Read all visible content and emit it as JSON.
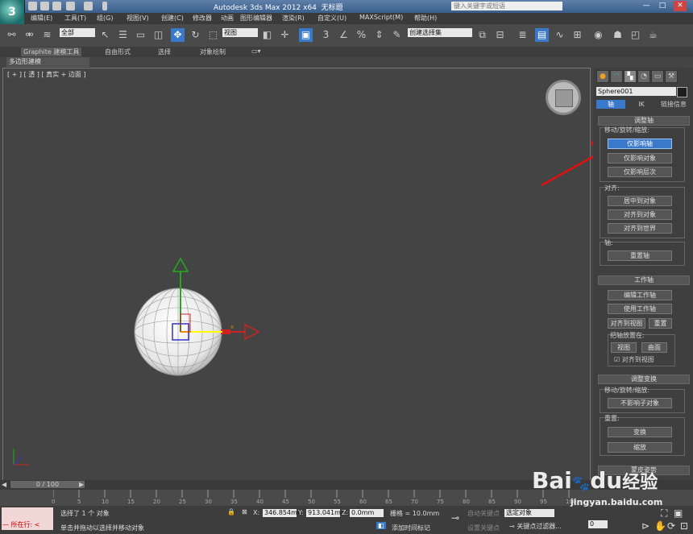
{
  "title_bar": {
    "title": "Autodesk 3ds Max  2012 x64",
    "document": "无标题",
    "search_placeholder": "键入关键字或短语",
    "window_buttons": [
      "—",
      "□",
      "✕"
    ]
  },
  "menu": [
    "编辑(E)",
    "工具(T)",
    "组(G)",
    "视图(V)",
    "创建(C)",
    "修改器",
    "动画",
    "图形编辑器",
    "渲染(R)",
    "自定义(U)",
    "MAXScript(M)",
    "帮助(H)"
  ],
  "toolbar": {
    "selection_filter": "全部",
    "reference_coord": "视图",
    "named_selection": "创建选择集"
  },
  "ribbon": {
    "tabs": [
      "Graphite 建模工具",
      "自由形式",
      "选择",
      "对象绘制"
    ],
    "subpanel": "多边形建模"
  },
  "viewport": {
    "label": "[ + ] [ 透 ] [ 真实 + 边面 ]",
    "gizmo_x_label": "x"
  },
  "command_panel": {
    "object_name": "Sphere001",
    "object_color": "#1e1e1e",
    "hier_tabs": [
      "轴",
      "IK",
      "链接信息"
    ],
    "adjust_pivot": {
      "title": "调整轴",
      "move_rotate_scale": "移动/旋转/缩放:",
      "affect_pivot_only": "仅影响轴",
      "affect_object_only": "仅影响对象",
      "affect_hierarchy_only": "仅影响层次",
      "alignment_label": "对齐:",
      "center_to_object": "居中到对象",
      "align_to_object": "对齐到对象",
      "align_to_world": "对齐到世界",
      "pivot_label": "轴:",
      "reset_pivot": "重置轴"
    },
    "working_pivot": {
      "title": "工作轴",
      "edit_working_pivot": "编辑工作轴",
      "use_working_pivot": "使用工作轴",
      "align_to_view": "对齐到视图",
      "reset": "重置",
      "place_pivot_to": "把轴放置在:",
      "view": "视图",
      "surface": "曲面",
      "align_to_view_checkbox": "对齐到视图"
    },
    "adjust_transform": {
      "title": "调整变换",
      "move_rotate_scale": "移动/旋转/缩放:",
      "dont_affect_children": "不影响子对象",
      "reset_label": "重置:",
      "transform": "变换",
      "scale": "缩放"
    },
    "skin_pose": "蒙皮姿势"
  },
  "timeline": {
    "slider": "0 / 100",
    "ticks": [
      "0",
      "5",
      "10",
      "15",
      "20",
      "25",
      "30",
      "35",
      "40",
      "45",
      "50",
      "55",
      "60",
      "65",
      "70",
      "75",
      "80",
      "85",
      "90",
      "95",
      "100"
    ]
  },
  "status": {
    "listener": "所在行:",
    "selected": "选择了 1 个 对象",
    "prompt": "单击并拖动以选择并移动对象",
    "x_label": "X:",
    "x_value": "346.854mr",
    "y_label": "Y:",
    "y_value": "913.041mr",
    "z_label": "Z:",
    "z_value": "0.0mm",
    "grid": "栅格 = 10.0mm",
    "add_time_tag": "添加时间标记",
    "auto_key": "自动关键点",
    "set_key": "设置关键点",
    "selected_dropdown": "选定对象",
    "key_filters": "关键点过滤器...",
    "frame": "0"
  },
  "watermark": {
    "brand": "Bai",
    "brand2": "du",
    "brand_cn": "经验",
    "url": "jingyan.baidu.com"
  }
}
